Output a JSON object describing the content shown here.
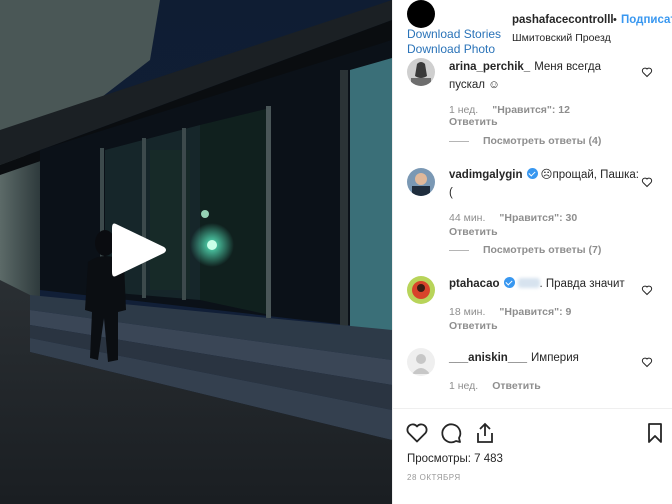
{
  "header": {
    "download_stories": "Download Stories",
    "download_photo": "Download Photo",
    "username": "pashafacecontrolll",
    "separator": "•",
    "follow": "Подписаться",
    "location": "Шмитовский Проезд"
  },
  "comments": [
    {
      "username": "arina_perchik_",
      "text": "Меня всегда пускал ☺",
      "time": "1 нед.",
      "likes": "\"Нравится\": 12",
      "reply": "Ответить",
      "view_replies": "Посмотреть ответы (4)"
    },
    {
      "username": "vadimgalygin",
      "text": "☹прощай, Пашка:(",
      "time": "44 мин.",
      "likes": "\"Нравится\": 30",
      "reply": "Ответить",
      "view_replies": "Посмотреть ответы (7)"
    },
    {
      "username": "ptahacao",
      "text": ". Правда значит",
      "time": "18 мин.",
      "likes": "\"Нравится\": 9",
      "reply": "Ответить"
    },
    {
      "username": "___aniskin___",
      "text": "Империя",
      "time": "1 нед.",
      "reply": "Ответить"
    }
  ],
  "footer": {
    "views": "Просмотры: 7 483",
    "date": "28 ОКТЯБРЯ"
  },
  "icons": {
    "play": "play-icon",
    "heart": "heart-icon",
    "comment": "comment-icon",
    "share": "share-icon",
    "save": "bookmark-icon"
  },
  "colors": {
    "link": "#2a73b8",
    "follow": "#3897f0",
    "secondary_text": "#8e8e8e"
  }
}
